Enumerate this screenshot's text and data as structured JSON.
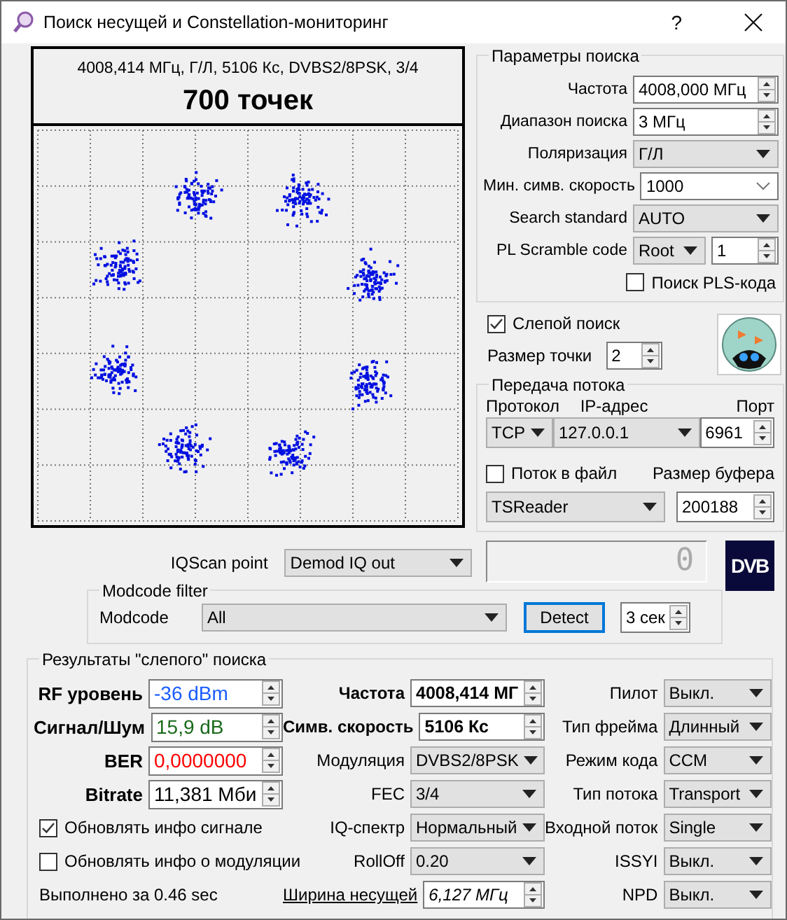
{
  "window": {
    "title": "Поиск несущей и Constellation-мониторинг",
    "help": "?"
  },
  "plot": {
    "header": "4008,414 МГц, Г/Л, 5106 Кс, DVBS2/8PSK, 3/4",
    "count": "700 точек"
  },
  "search_params": {
    "title": "Параметры поиска",
    "rows": [
      {
        "kind": "spin",
        "label": "Частота",
        "value": "4008,000 МГц"
      },
      {
        "kind": "spin",
        "label": "Диапазон поиска",
        "value": "3 МГц"
      },
      {
        "kind": "combo",
        "label": "Поляризация",
        "value": "Г/Л"
      },
      {
        "kind": "editcombo",
        "label": "Мин. симв. скорость",
        "value": "1000"
      },
      {
        "kind": "combo",
        "label": "Search standard",
        "value": "AUTO"
      },
      {
        "kind": "combospin",
        "label": "PL Scramble code",
        "value": "Root",
        "value2": "1"
      },
      {
        "kind": "checkbox",
        "label": "Поиск PLS-кода",
        "checked": false
      }
    ]
  },
  "blind_search": {
    "label": "Слепой поиск",
    "checked": true
  },
  "point_size": {
    "label": "Размер точки",
    "value": "2"
  },
  "stream": {
    "title": "Передача потока",
    "protocol_label": "Протокол",
    "ip_label": "IP-адрес",
    "port_label": "Порт",
    "protocol": "TCP",
    "ip": "127.0.0.1",
    "port": "6961",
    "file_label": "Поток в файл",
    "file_checked": false,
    "buffer_label": "Размер буфера",
    "player": "TSReader",
    "buffer": "200188"
  },
  "iqscan": {
    "label": "IQScan point",
    "value": "Demod IQ out"
  },
  "lcd": "0",
  "logo_text": "DVB",
  "modcode_filter": {
    "title": "Modcode filter",
    "label": "Modcode",
    "value": "All",
    "detect": "Detect",
    "timeout": "3 сек"
  },
  "results": {
    "title": "Результаты \"слепого\" поиска",
    "signal": [
      {
        "label": "RF уровень",
        "value": "-36 dBm",
        "color": "#1a5cff"
      },
      {
        "label": "Сигнал/Шум",
        "value": "15,9 dB",
        "color": "#1a6a1a"
      },
      {
        "label": "BER",
        "value": "0,0000000",
        "color": "#ff0000"
      },
      {
        "label": "Bitrate",
        "value": "11,381 Мби",
        "color": "#000000"
      }
    ],
    "options": [
      {
        "label": "Обновлять инфо сигнале",
        "checked": true
      },
      {
        "label": "Обновлять инфо о модуляции",
        "checked": false
      }
    ],
    "elapsed": "Выполнено за 0.46 sec",
    "middle": [
      {
        "kind": "spin",
        "label": "Частота",
        "value": "4008,414 МГ",
        "bold": true
      },
      {
        "kind": "spin",
        "label": "Симв. скорость",
        "value": "5106 Кс",
        "bold": true
      },
      {
        "kind": "combo",
        "label": "Модуляция",
        "value": "DVBS2/8PSK"
      },
      {
        "kind": "combo",
        "label": "FEC",
        "value": "3/4"
      },
      {
        "kind": "combo",
        "label": "IQ-спектр",
        "value": "Нормальный"
      },
      {
        "kind": "combo",
        "label": "RollOff",
        "value": "0.20"
      },
      {
        "kind": "linkspin",
        "label": "Ширина несущей",
        "value": "6,127 МГц"
      }
    ],
    "right": [
      {
        "label": "Пилот",
        "value": "Выкл."
      },
      {
        "label": "Тип фрейма",
        "value": "Длинный"
      },
      {
        "label": "Режим кода",
        "value": "CCM"
      },
      {
        "label": "Тип потока",
        "value": "Transport"
      },
      {
        "label": "Входной поток",
        "value": "Single"
      },
      {
        "label": "ISSYI",
        "value": "Выкл."
      },
      {
        "label": "NPD",
        "value": "Выкл."
      }
    ]
  }
}
